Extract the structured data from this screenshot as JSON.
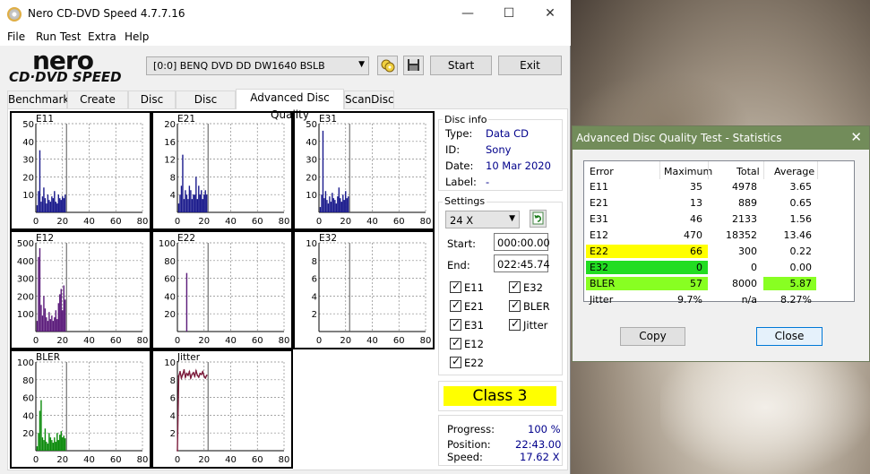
{
  "window": {
    "title": "Nero CD-DVD Speed 4.7.7.16",
    "minimize_label": "—",
    "maximize_label": "☐",
    "close_label": "✕"
  },
  "menu": [
    "File",
    "Run Test",
    "Extra",
    "Help"
  ],
  "logo": {
    "top": "nero",
    "bottom": "CD·DVD SPEED"
  },
  "toolbar": {
    "drive": "[0:0]   BENQ DVD DD DW1640 BSLB",
    "start_label": "Start",
    "exit_label": "Exit"
  },
  "tabs": [
    "Benchmark",
    "Create Disc",
    "Disc Info",
    "Disc Quality",
    "Advanced Disc Quality",
    "ScanDisc"
  ],
  "active_tab": "Advanced Disc Quality",
  "disc_info": {
    "title": "Disc info",
    "type_label": "Type:",
    "type_value": "Data CD",
    "id_label": "ID:",
    "id_value": "Sony",
    "date_label": "Date:",
    "date_value": "10 Mar 2020",
    "label_label": "Label:",
    "label_value": "-"
  },
  "settings": {
    "title": "Settings",
    "speed": "24 X",
    "start_label": "Start:",
    "start_value": "000:00.00",
    "end_label": "End:",
    "end_value": "022:45.74",
    "checkboxes": [
      "E11",
      "E21",
      "E31",
      "E12",
      "E22",
      "E32",
      "BLER",
      "Jitter"
    ]
  },
  "class_badge": "Class 3",
  "progress": {
    "progress_label": "Progress:",
    "progress_value": "100 %",
    "position_label": "Position:",
    "position_value": "22:43.00",
    "speed_label": "Speed:",
    "speed_value": "17.62 X"
  },
  "colors": {
    "e11": "#1a1a8c",
    "e21": "#1a1a8c",
    "e31": "#1a1a8c",
    "e12": "#5a1a7a",
    "e22": "#5a1a7a",
    "e32": "#5a1a7a",
    "bler": "#0a8a0a",
    "jitter": "#7a1a3a",
    "yellow": "#ffff00",
    "green": "#00cc00",
    "lime": "#80ff00"
  },
  "chart_data": [
    {
      "type": "bar",
      "title": "E11",
      "x_ticks": [
        "0",
        "20",
        "40",
        "60",
        "80"
      ],
      "y_ticks": [
        "50",
        "40",
        "30",
        "20",
        "10"
      ],
      "ylim": [
        0,
        50
      ],
      "xlim": [
        0,
        80
      ],
      "marker_x": 23,
      "series_color": "e11",
      "x": [
        1,
        2,
        3,
        4,
        5,
        6,
        7,
        8,
        9,
        10,
        11,
        12,
        13,
        14,
        15,
        16,
        17,
        18,
        19,
        20,
        21,
        22
      ],
      "values": [
        4,
        12,
        35,
        6,
        9,
        14,
        8,
        5,
        10,
        7,
        6,
        9,
        8,
        12,
        6,
        5,
        10,
        8,
        7,
        9,
        8,
        10
      ]
    },
    {
      "type": "bar",
      "title": "E21",
      "x_ticks": [
        "0",
        "20",
        "40",
        "60",
        "80"
      ],
      "y_ticks": [
        "20",
        "16",
        "12",
        "8",
        "4"
      ],
      "ylim": [
        0,
        20
      ],
      "xlim": [
        0,
        80
      ],
      "marker_x": 23,
      "series_color": "e21",
      "x": [
        1,
        2,
        3,
        4,
        5,
        6,
        7,
        8,
        9,
        10,
        11,
        12,
        13,
        14,
        15,
        16,
        17,
        18,
        19,
        20,
        21,
        22
      ],
      "values": [
        2,
        4,
        6,
        13,
        3,
        5,
        4,
        3,
        6,
        5,
        3,
        4,
        4,
        8,
        3,
        6,
        4,
        5,
        3,
        4,
        5,
        4
      ]
    },
    {
      "type": "bar",
      "title": "E31",
      "x_ticks": [
        "0",
        "20",
        "40",
        "60",
        "80"
      ],
      "y_ticks": [
        "50",
        "40",
        "30",
        "20",
        "10"
      ],
      "ylim": [
        0,
        50
      ],
      "xlim": [
        0,
        80
      ],
      "marker_x": 23,
      "series_color": "e31",
      "x": [
        1,
        2,
        3,
        4,
        5,
        6,
        7,
        8,
        9,
        10,
        11,
        12,
        13,
        14,
        15,
        16,
        17,
        18,
        19,
        20,
        21,
        22
      ],
      "values": [
        3,
        10,
        46,
        8,
        12,
        7,
        5,
        9,
        6,
        11,
        8,
        7,
        5,
        9,
        14,
        8,
        6,
        10,
        7,
        12,
        8,
        9
      ]
    },
    {
      "type": "bar",
      "title": "E12",
      "x_ticks": [
        "0",
        "20",
        "40",
        "60",
        "80"
      ],
      "y_ticks": [
        "500",
        "400",
        "300",
        "200",
        "100"
      ],
      "ylim": [
        0,
        500
      ],
      "xlim": [
        0,
        80
      ],
      "marker_x": 23,
      "series_color": "e12",
      "x": [
        1,
        2,
        3,
        4,
        5,
        6,
        7,
        8,
        9,
        10,
        11,
        12,
        13,
        14,
        15,
        16,
        17,
        18,
        19,
        20,
        21,
        22
      ],
      "values": [
        60,
        420,
        470,
        150,
        90,
        200,
        130,
        80,
        60,
        110,
        70,
        90,
        60,
        80,
        120,
        70,
        160,
        210,
        240,
        120,
        260,
        180
      ]
    },
    {
      "type": "bar",
      "title": "E22",
      "x_ticks": [
        "0",
        "20",
        "40",
        "60",
        "80"
      ],
      "y_ticks": [
        "100",
        "80",
        "60",
        "40",
        "20"
      ],
      "ylim": [
        0,
        100
      ],
      "xlim": [
        0,
        80
      ],
      "marker_x": 23,
      "series_color": "e22",
      "x": [
        7
      ],
      "values": [
        66
      ]
    },
    {
      "type": "bar",
      "title": "E32",
      "x_ticks": [
        "0",
        "20",
        "40",
        "60",
        "80"
      ],
      "y_ticks": [
        "10",
        "8",
        "6",
        "4",
        "2"
      ],
      "ylim": [
        0,
        10
      ],
      "xlim": [
        0,
        80
      ],
      "marker_x": 23,
      "series_color": "e32",
      "x": [],
      "values": []
    },
    {
      "type": "bar",
      "title": "BLER",
      "x_ticks": [
        "0",
        "20",
        "40",
        "60",
        "80"
      ],
      "y_ticks": [
        "100",
        "80",
        "60",
        "40",
        "20"
      ],
      "ylim": [
        0,
        100
      ],
      "xlim": [
        0,
        80
      ],
      "marker_x": 23,
      "series_color": "bler",
      "x": [
        1,
        2,
        3,
        4,
        5,
        6,
        7,
        8,
        9,
        10,
        11,
        12,
        13,
        14,
        15,
        16,
        17,
        18,
        19,
        20,
        21,
        22
      ],
      "values": [
        5,
        20,
        45,
        57,
        15,
        12,
        25,
        10,
        8,
        20,
        15,
        12,
        9,
        15,
        10,
        20,
        12,
        18,
        22,
        15,
        17,
        14
      ]
    },
    {
      "type": "line",
      "title": "Jitter",
      "x_ticks": [
        "0",
        "20",
        "40",
        "60",
        "80"
      ],
      "y_ticks": [
        "10",
        "8",
        "6",
        "4",
        "2"
      ],
      "ylim": [
        0,
        10
      ],
      "xlim": [
        0,
        80
      ],
      "marker_x": 23,
      "series_color": "jitter",
      "x": [
        0,
        1,
        2,
        3,
        4,
        5,
        6,
        7,
        8,
        9,
        10,
        11,
        12,
        13,
        14,
        15,
        16,
        17,
        18,
        19,
        20,
        21,
        22
      ],
      "values": [
        0,
        8.4,
        8.9,
        8.2,
        8.6,
        9.1,
        8.3,
        8.7,
        8.5,
        8.9,
        8.2,
        8.6,
        8.8,
        8.4,
        9.0,
        8.5,
        8.3,
        8.7,
        8.6,
        8.9,
        8.4,
        8.2,
        8.5
      ]
    }
  ],
  "stats": {
    "title": "Advanced Disc Quality Test - Statistics",
    "close_label": "✕",
    "headers": [
      "Error",
      "Maximum",
      "Total",
      "Average"
    ],
    "rows": [
      {
        "name": "E11",
        "max": "35",
        "total": "4978",
        "avg": "3.65",
        "hl": "",
        "avg_hl": ""
      },
      {
        "name": "E21",
        "max": "13",
        "total": "889",
        "avg": "0.65",
        "hl": "",
        "avg_hl": ""
      },
      {
        "name": "E31",
        "max": "46",
        "total": "2133",
        "avg": "1.56",
        "hl": "",
        "avg_hl": ""
      },
      {
        "name": "E12",
        "max": "470",
        "total": "18352",
        "avg": "13.46",
        "hl": "",
        "avg_hl": ""
      },
      {
        "name": "E22",
        "max": "66",
        "total": "300",
        "avg": "0.22",
        "hl": "#ffff00",
        "avg_hl": ""
      },
      {
        "name": "E32",
        "max": "0",
        "total": "0",
        "avg": "0.00",
        "hl": "#22dd22",
        "avg_hl": ""
      },
      {
        "name": "BLER",
        "max": "57",
        "total": "8000",
        "avg": "5.87",
        "hl": "#88ff22",
        "avg_hl": "#88ff22"
      },
      {
        "name": "Jitter",
        "max": "9.7%",
        "total": "n/a",
        "avg": "8.27%",
        "hl": "",
        "avg_hl": ""
      }
    ],
    "copy_label": "Copy",
    "close_button_label": "Close"
  }
}
